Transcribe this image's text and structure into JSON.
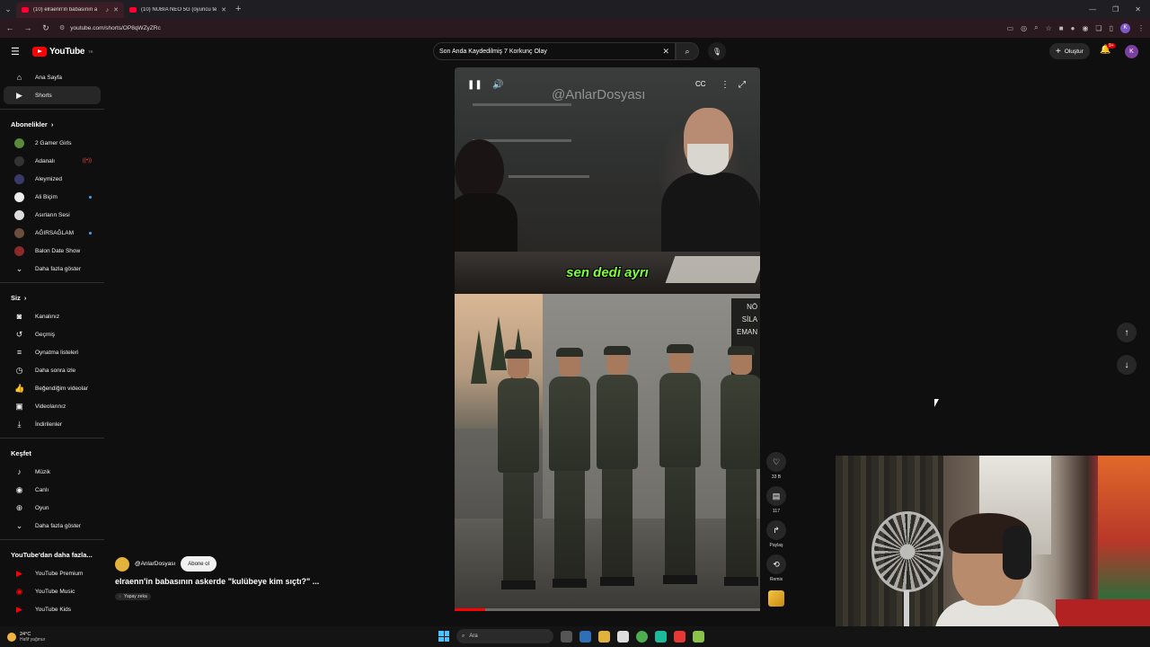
{
  "browser": {
    "tabs": [
      {
        "title": "(10) elraenn'in babasının a",
        "active": true
      },
      {
        "title": "(10) NUBIA NEO 5G (oyuncu te",
        "active": false
      }
    ],
    "url": "youtube.com/shorts/OP8qWZyZRc"
  },
  "header": {
    "logo_text": "YouTube",
    "logo_sup": "TR",
    "search_value": "Son Anda Kaydedilmiş 7 Korkunç Olay",
    "create_label": "Oluştur",
    "notif_badge": "9+",
    "avatar_letter": "K"
  },
  "sidebar": {
    "main": [
      {
        "label": "Ana Sayfa",
        "icon": "home-icon"
      },
      {
        "label": "Shorts",
        "icon": "shorts-icon",
        "active": true
      }
    ],
    "subs_title": "Abonelikler",
    "subs": [
      {
        "label": "2 Gamer Girls",
        "color": "#5a8a3a"
      },
      {
        "label": "Adanalı",
        "color": "#333333",
        "live": true
      },
      {
        "label": "Aleymized",
        "color": "#3a3a6a"
      },
      {
        "label": "Ali Biçim",
        "color": "#eeeeee",
        "dot": true
      },
      {
        "label": "Asırların Sesi",
        "color": "#dddddd"
      },
      {
        "label": "AĞIRSAĞLAM",
        "color": "#6b4e3d",
        "dot": true
      },
      {
        "label": "Balon Date Show",
        "color": "#8a2a2a"
      }
    ],
    "subs_more": "Daha fazla göster",
    "you_title": "Siz",
    "you": [
      {
        "label": "Kanalınız",
        "icon": "user-icon"
      },
      {
        "label": "Geçmiş",
        "icon": "history-icon"
      },
      {
        "label": "Oynatma listeleri",
        "icon": "playlist-icon"
      },
      {
        "label": "Daha sonra izle",
        "icon": "clock-icon"
      },
      {
        "label": "Beğendiğim videolar",
        "icon": "like-icon"
      },
      {
        "label": "Videolarınız",
        "icon": "video-icon"
      },
      {
        "label": "İndirilenler",
        "icon": "download-icon"
      }
    ],
    "explore_title": "Keşfet",
    "explore": [
      {
        "label": "Müzik",
        "icon": "music-icon"
      },
      {
        "label": "Canlı",
        "icon": "live-icon"
      },
      {
        "label": "Oyun",
        "icon": "gaming-icon"
      }
    ],
    "explore_more": "Daha fazla göster",
    "more_title": "YouTube'dan daha fazla...",
    "more": [
      {
        "label": "YouTube Premium"
      },
      {
        "label": "YouTube Music"
      },
      {
        "label": "YouTube Kids"
      }
    ]
  },
  "short": {
    "watermark": "@AnlarDosyası",
    "caption": "sen dedi ayrı",
    "building_text": "NÖ\nSİLA\nEMAN",
    "progress": 0.1,
    "channel": "@AnlarDosyası",
    "subscribe": "Abone ol",
    "title": "elraenn'in babasının askerde \"kulübeye kim sıçtı?\" ...",
    "ai_chip": "Yapay zeka",
    "likes": "33 B",
    "comments": "117",
    "share": "Paylaş",
    "remix": "Remix"
  },
  "taskbar": {
    "temp": "24°C",
    "condition": "Hafif yağmur",
    "search_placeholder": "Ara"
  }
}
